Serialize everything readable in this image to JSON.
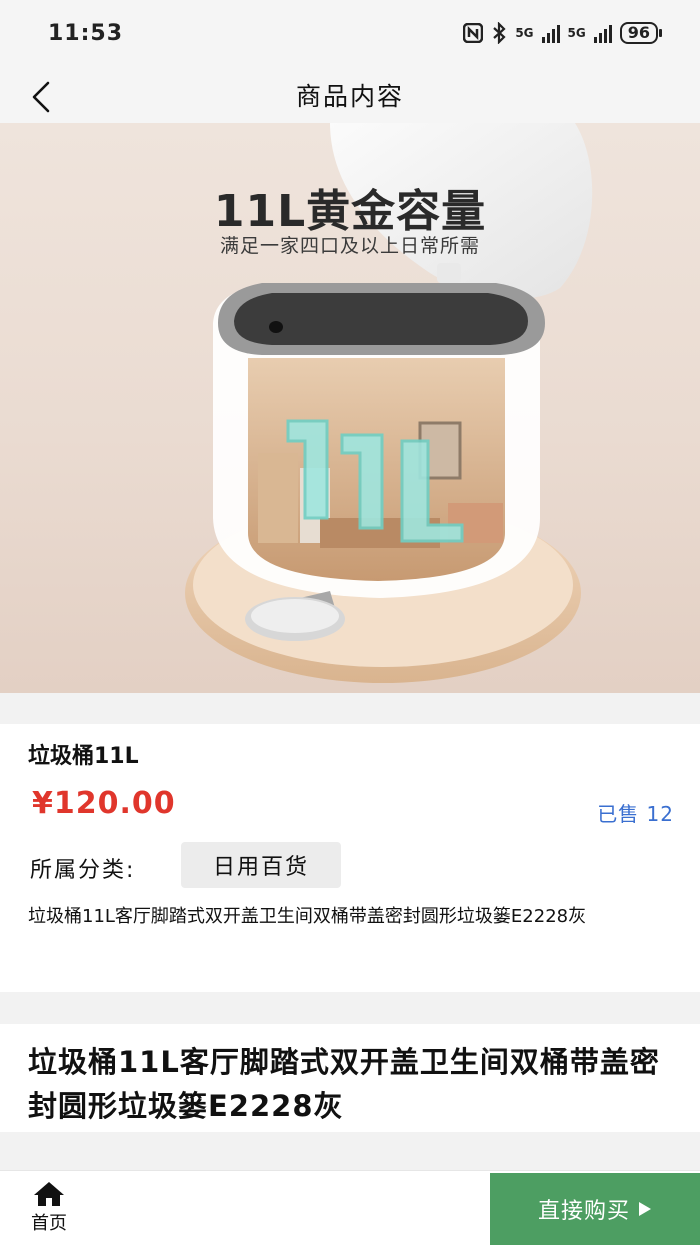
{
  "status": {
    "time": "11:53",
    "battery": "96",
    "network1": "5G",
    "network2": "5G"
  },
  "nav": {
    "title": "商品内容"
  },
  "banner": {
    "headline": "11L黄金容量",
    "subline": "满足一家四口及以上日常所需",
    "big_text": "11L"
  },
  "product": {
    "name": "垃圾桶11L",
    "price": "¥120.00",
    "sold": "已售 12",
    "category_label": "所属分类:",
    "category_value": "日用百货",
    "description": "垃圾桶11L客厅脚踏式双开盖卫生间双桶带盖密封圆形垃圾篓E2228灰"
  },
  "detail": {
    "title": "垃圾桶11L客厅脚踏式双开盖卫生间双桶带盖密封圆形垃圾篓E2228灰"
  },
  "bottom_bar": {
    "home_label": "首页",
    "buy_label": "直接购买"
  },
  "colors": {
    "price": "#e0362c",
    "sold": "#3a6fd0",
    "buy_button": "#4d9e62"
  }
}
